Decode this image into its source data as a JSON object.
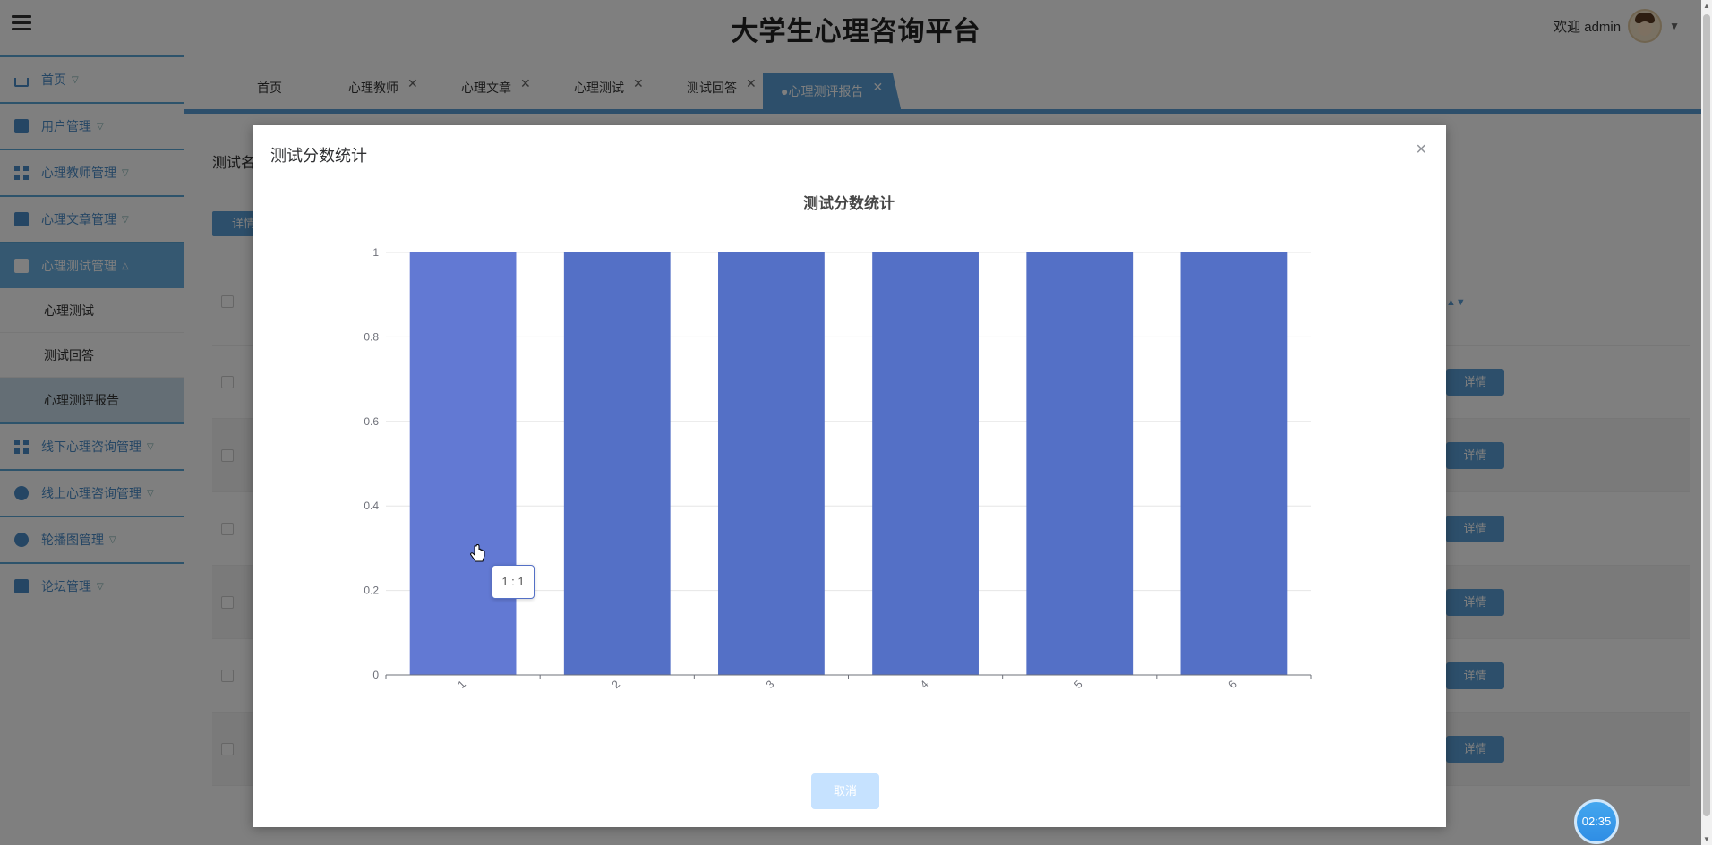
{
  "header": {
    "site_title": "大学生心理咨询平台",
    "welcome": "欢迎 admin"
  },
  "sidebar": {
    "items": [
      {
        "label": "首页",
        "icon": "home-icon"
      },
      {
        "label": "用户管理",
        "icon": "user-card-icon"
      },
      {
        "label": "心理教师管理",
        "icon": "grid-icon"
      },
      {
        "label": "心理文章管理",
        "icon": "briefcase-icon"
      },
      {
        "label": "心理测试管理",
        "icon": "book-icon"
      },
      {
        "label": "线下心理咨询管理",
        "icon": "apps-icon"
      },
      {
        "label": "线上心理咨询管理",
        "icon": "chat-icon"
      },
      {
        "label": "轮播图管理",
        "icon": "drop-icon"
      },
      {
        "label": "论坛管理",
        "icon": "cart-icon"
      }
    ],
    "sub_items": [
      "心理测试",
      "测试回答",
      "心理测评报告"
    ]
  },
  "tabs": [
    {
      "label": "首页",
      "closable": false
    },
    {
      "label": "心理教师",
      "closable": true
    },
    {
      "label": "心理文章",
      "closable": true
    },
    {
      "label": "心理测试",
      "closable": true
    },
    {
      "label": "测试回答",
      "closable": true
    },
    {
      "label": "●心理测评报告",
      "closable": true,
      "active": true
    }
  ],
  "content": {
    "filter_label": "测试名",
    "top_button": "详情",
    "row_button": "详情"
  },
  "modal": {
    "title": "测试分数统计",
    "close_symbol": "×",
    "cancel_label": "取消"
  },
  "tooltip": {
    "text": "1 : 1"
  },
  "timer": {
    "text": "02:35"
  },
  "colors": {
    "accent": "#5a9fd6",
    "bar": "#5470c6"
  },
  "chart_data": {
    "type": "bar",
    "title": "测试分数统计",
    "categories": [
      "1",
      "2",
      "3",
      "4",
      "5",
      "6"
    ],
    "values": [
      1,
      1,
      1,
      1,
      1,
      1
    ],
    "ylim": [
      0,
      1
    ],
    "yticks": [
      "0",
      "0.2",
      "0.4",
      "0.6",
      "0.8",
      "1"
    ],
    "grid": true
  }
}
